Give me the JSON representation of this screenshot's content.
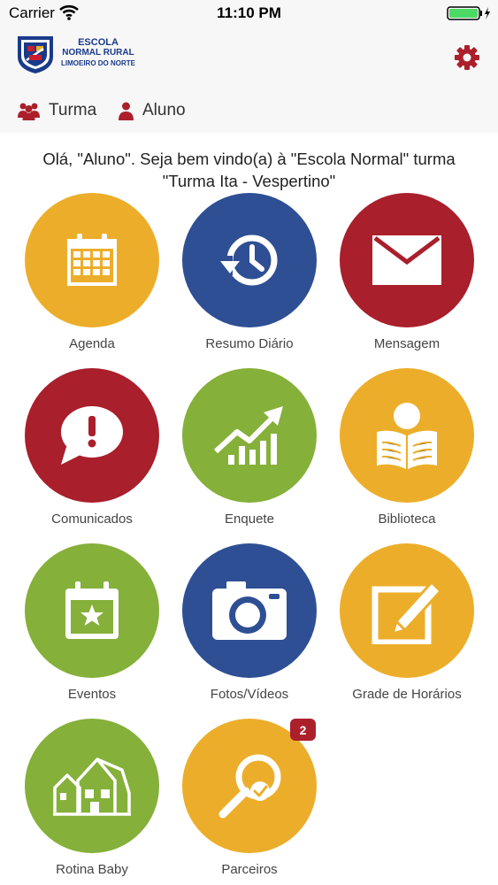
{
  "status_bar": {
    "carrier": "Carrier",
    "time": "11:10 PM"
  },
  "header": {
    "logo": {
      "line1": "ESCOLA",
      "line2": "NORMAL RURAL",
      "line3": "LIMOEIRO DO NORTE"
    },
    "settings_icon": "gear-icon",
    "nav": [
      {
        "label": "Turma",
        "icon": "group-icon"
      },
      {
        "label": "Aluno",
        "icon": "user-icon"
      }
    ]
  },
  "welcome": {
    "line1": "Olá, \"Aluno\". Seja bem vindo(a) à \"Escola Normal\" turma",
    "line2": "\"Turma Ita - Vespertino\""
  },
  "colors": {
    "yellow": "#ecae2a",
    "blue": "#2e4f93",
    "red": "#a91f2c",
    "green": "#85b03a"
  },
  "menu": [
    {
      "label": "Agenda",
      "icon": "calendar-icon",
      "color": "#ecae2a"
    },
    {
      "label": "Resumo Diário",
      "icon": "history-icon",
      "color": "#2e4f93"
    },
    {
      "label": "Mensagem",
      "icon": "envelope-icon",
      "color": "#a91f2c"
    },
    {
      "label": "Comunicados",
      "icon": "alert-bubble-icon",
      "color": "#a91f2c"
    },
    {
      "label": "Enquete",
      "icon": "chart-growth-icon",
      "color": "#85b03a"
    },
    {
      "label": "Biblioteca",
      "icon": "reader-book-icon",
      "color": "#ecae2a"
    },
    {
      "label": "Eventos",
      "icon": "calendar-star-icon",
      "color": "#85b03a"
    },
    {
      "label": "Fotos/Vídeos",
      "icon": "camera-icon",
      "color": "#2e4f93"
    },
    {
      "label": "Grade de Horários",
      "icon": "edit-pencil-icon",
      "color": "#ecae2a"
    },
    {
      "label": "Rotina Baby",
      "icon": "houses-icon",
      "color": "#85b03a"
    },
    {
      "label": "Parceiros",
      "icon": "search-check-icon",
      "color": "#ecae2a",
      "badge": "2"
    }
  ]
}
